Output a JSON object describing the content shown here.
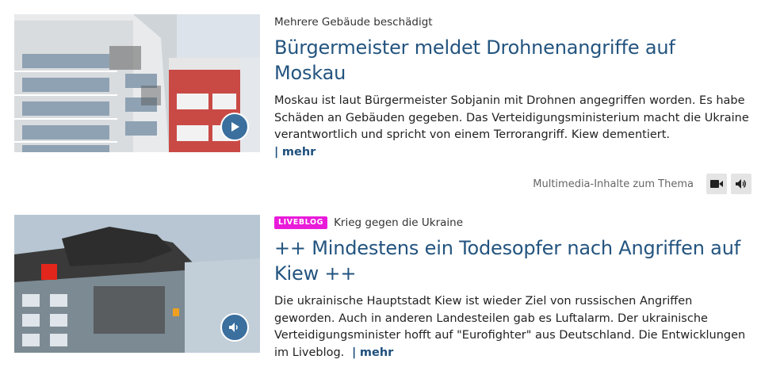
{
  "teasers": [
    {
      "topline": "Mehrere Gebäude beschädigt",
      "headline": "Bürgermeister meldet Drohnenangriffe auf Moskau",
      "shorttext": "Moskau ist laut Bürgermeister Sobjanin mit Drohnen angegriffen worden. Es habe Schäden an Gebäuden gegeben. Das Verteidigungsministerium macht die Ukraine verantwortlich und spricht von einem Terrorangriff. Kiew dementiert.",
      "more_label": "mehr",
      "media_icon": "play-icon"
    },
    {
      "badge": "LIVEBLOG",
      "topline": "Krieg gegen die Ukraine",
      "headline": "++ Mindestens ein Todesopfer nach Angriffen auf Kiew ++",
      "shorttext": "Die ukrainische Hauptstadt Kiew ist wieder Ziel von russischen Angriffen geworden. Auch in anderen Landesteilen gab es Luftalarm. Der ukrainische Verteidigungsminister hofft auf \"Eurofighter\" aus Deutschland. Die Entwicklungen im Liveblog.",
      "more_label": "mehr",
      "media_icon": "speaker-icon"
    }
  ],
  "multimedia": {
    "label": "Multimedia-Inhalte zum Thema",
    "buttons": [
      "video-camera-icon",
      "speaker-icon"
    ]
  },
  "colors": {
    "headline": "#23547f",
    "badge": "#e91ad9",
    "media_button": "#3a6f9e"
  }
}
